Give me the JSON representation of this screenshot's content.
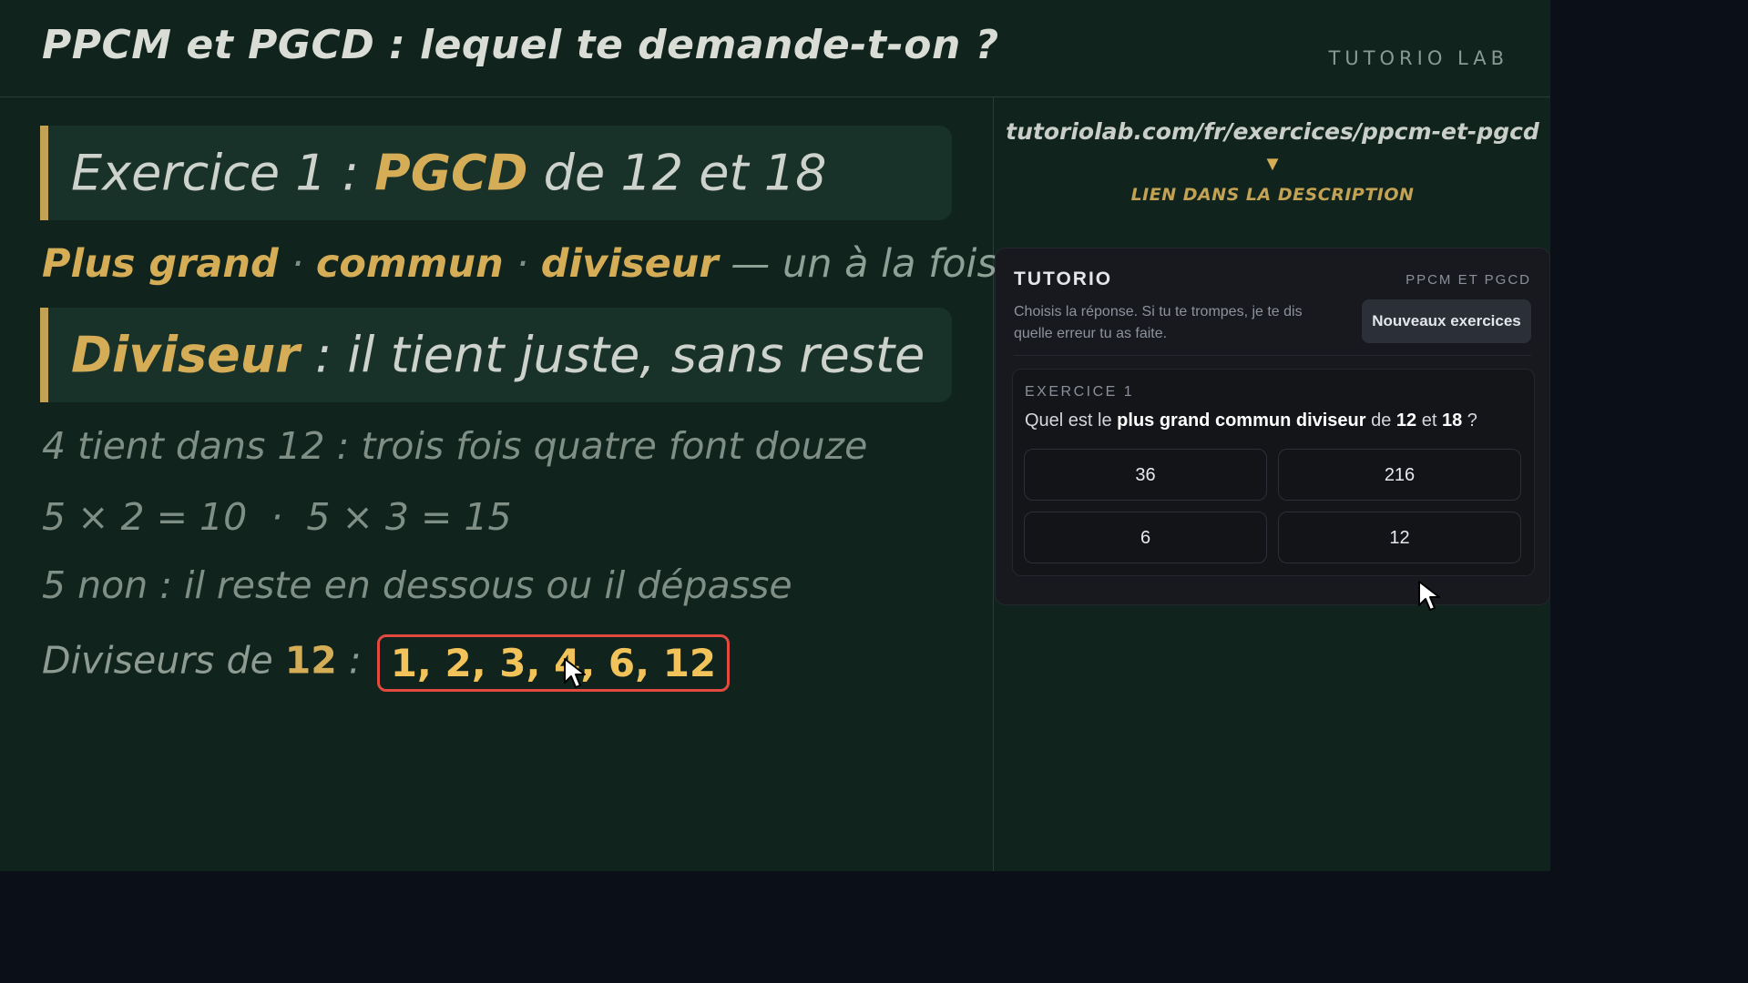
{
  "header": {
    "title": "PPCM et PGCD : lequel te demande-t-on ?",
    "brand": "TUTORIO LAB"
  },
  "exercise_header": {
    "prefix": "Exercice 1 : ",
    "keyword": "PGCD",
    "suffix": " de 12 et 18"
  },
  "subtitle": {
    "w1": "Plus grand",
    "sep1": " · ",
    "w2": "commun",
    "sep2": " · ",
    "w3": "diviseur",
    "rest": " — un à la fois"
  },
  "definition": {
    "keyword": "Diviseur",
    "rest": " : il tient juste, sans reste"
  },
  "lines": {
    "line1": "4 tient dans 12 : trois fois quatre font douze",
    "line2": "5 × 2 = 10  ·  5 × 3 = 15",
    "line3": "5 non : il reste en dessous ou il dépasse",
    "divisors_prefix": "Diviseurs de ",
    "divisors_number": "12",
    "divisors_colon": " : ",
    "divisors_list": "1, 2, 3, 4, 6, 12"
  },
  "link": {
    "url": "tutoriolab.com/fr/exercices/ppcm-et-pgcd",
    "arrow": "▼",
    "note": "LIEN DANS LA DESCRIPTION"
  },
  "widget": {
    "title": "TUTORIO",
    "tag": "PPCM ET PGCD",
    "description": "Choisis la réponse. Si tu te trompes, je te dis quelle erreur tu as faite.",
    "new_button": "Nouveaux exercices",
    "quiz": {
      "label": "EXERCICE 1",
      "q_prefix": "Quel est le ",
      "q_bold": "plus grand commun diviseur",
      "q_mid": " de ",
      "q_a": "12",
      "q_and": " et ",
      "q_b": "18",
      "q_end": " ?",
      "choices": [
        "36",
        "216",
        "6",
        "12"
      ]
    }
  },
  "colors": {
    "board": "#10231d",
    "accent_gold": "#d5ad57",
    "highlight_border": "#e24a3f",
    "widget_bg": "#17191f"
  }
}
